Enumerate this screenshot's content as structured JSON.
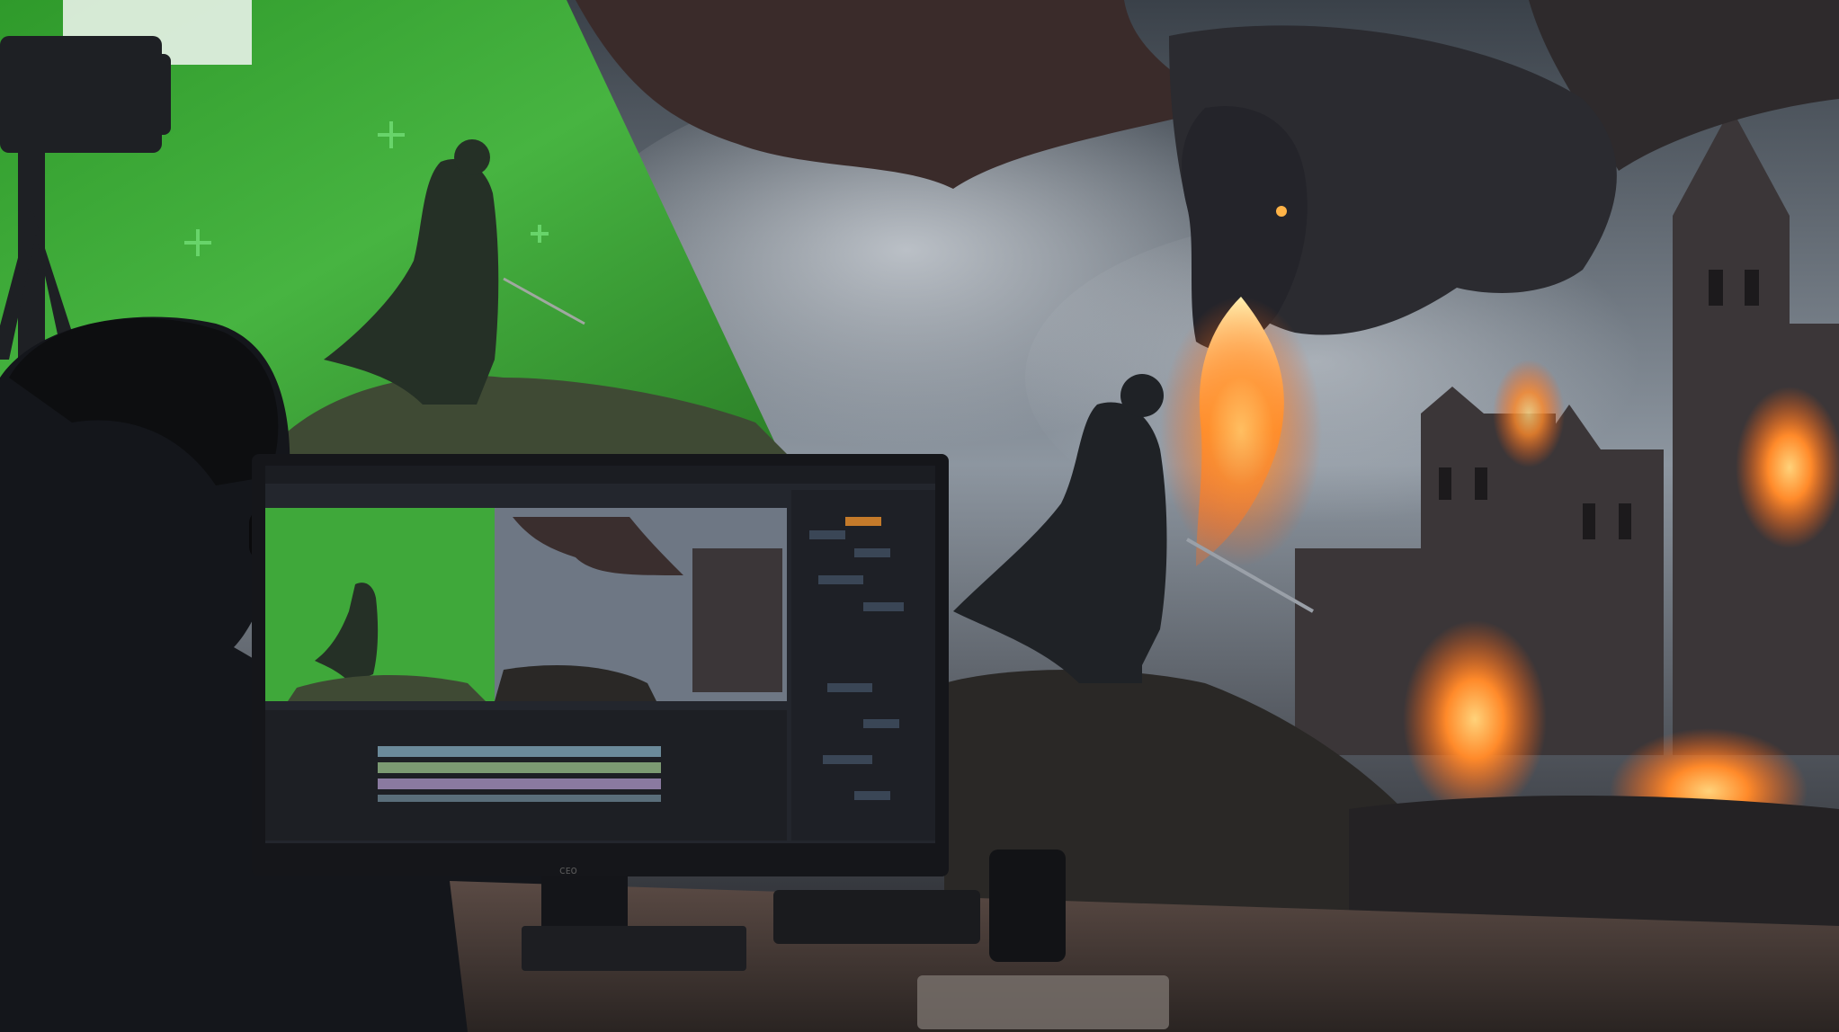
{
  "scene": {
    "description_free": true,
    "colors": {
      "greenscreen": "#3fae3a",
      "sky_dark": "#2a3038",
      "sky_light": "#9aa3ad",
      "fire": "#ff8a2a",
      "rock": "#2a2826",
      "dragon": "#2b2b30",
      "monitor_bezel": "#15161a",
      "desk": "#3a3230"
    }
  },
  "monitor": {
    "brand_glyph": "ᴄᴇᴏ"
  }
}
